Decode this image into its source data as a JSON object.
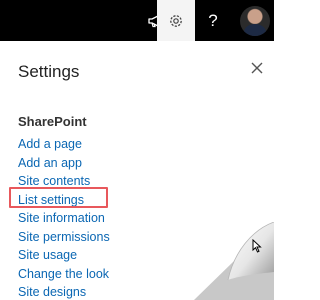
{
  "topbar": {
    "icons": [
      "megaphone-icon",
      "gear-icon",
      "help-icon",
      "avatar"
    ],
    "help_label": "?"
  },
  "panel": {
    "title": "Settings",
    "close_icon": "close-icon",
    "section_heading": "SharePoint",
    "links": [
      "Add a page",
      "Add an app",
      "Site contents",
      "List settings",
      "Site information",
      "Site permissions",
      "Site usage",
      "Change the look",
      "Site designs"
    ],
    "highlighted_link": "List settings"
  },
  "colors": {
    "topbar_bg": "#000000",
    "active_icon_bg": "#f4f4f4",
    "link": "#0b67b3",
    "highlight": "#e8585c"
  }
}
